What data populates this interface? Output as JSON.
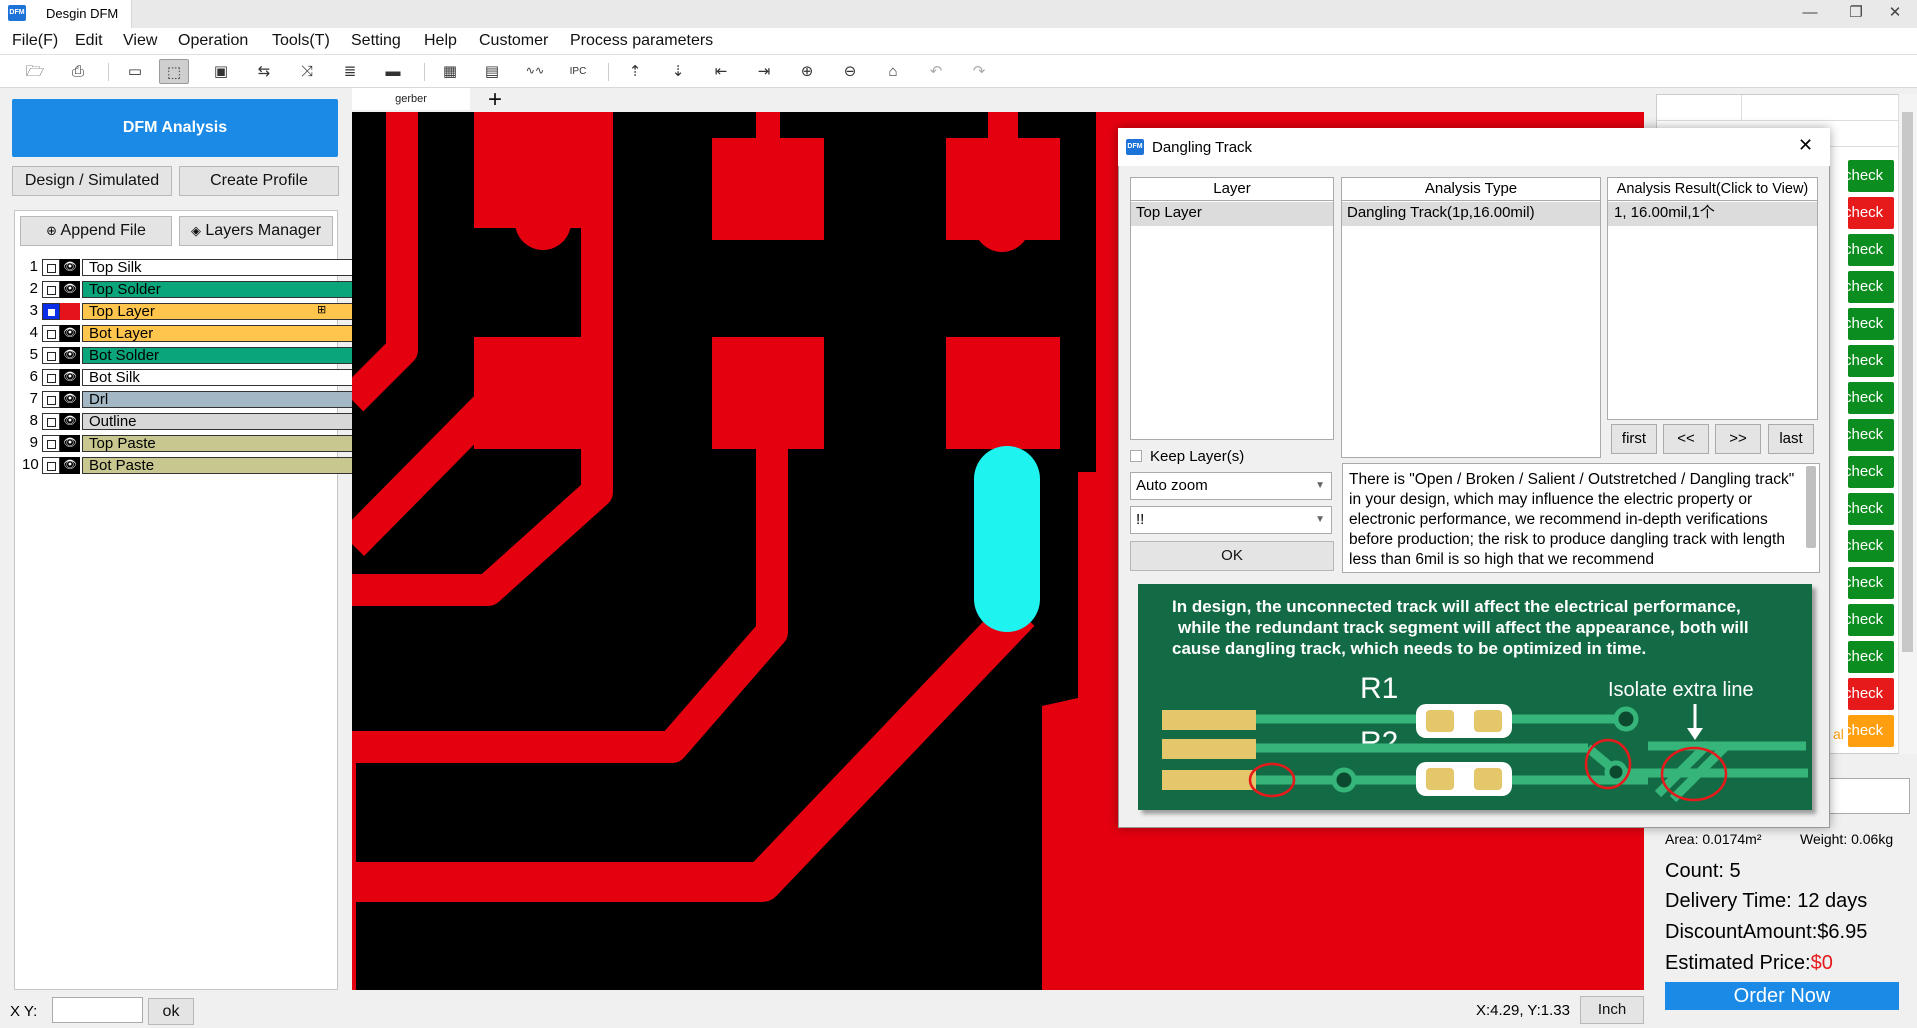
{
  "window": {
    "title": "Desgin DFM",
    "app_icon": "DFM",
    "minimize": "—",
    "maximize": "❐",
    "close": "✕"
  },
  "menu": [
    "File(F)",
    "Edit",
    "View",
    "Operation",
    "Tools(T)",
    "Setting",
    "Help",
    "Customer",
    "Process parameters"
  ],
  "toolbar": {
    "icons": [
      "open-file-icon",
      "print-icon",
      "window-icon",
      "select-icon",
      "zoom-box-icon",
      "route-icon",
      "split-icon",
      "stack-icon",
      "ruler-icon",
      "qr-icon",
      "chip-icon",
      "wave-icon",
      "ipc-icon",
      "export-icon",
      "import-icon",
      "align-left-icon",
      "align-right-icon",
      "zoom-in-icon",
      "zoom-out-icon",
      "home-icon",
      "undo-icon",
      "redo-icon"
    ]
  },
  "left": {
    "dfm_button": "DFM Analysis",
    "design_button": "Design / Simulated",
    "profile_button": "Create Profile",
    "append_button": "Append File",
    "layers_button": "Layers Manager",
    "layers": [
      {
        "num": "1",
        "name": "Top Silk",
        "color": "#ffffff",
        "eye": "👁"
      },
      {
        "num": "2",
        "name": "Top Solder",
        "color": "#0aa57a",
        "eye": "👁"
      },
      {
        "num": "3",
        "name": "Top Layer",
        "color": "#ffc54d",
        "eye": "",
        "selected": true
      },
      {
        "num": "4",
        "name": "Bot Layer",
        "color": "#ffc54d",
        "eye": "👁"
      },
      {
        "num": "5",
        "name": "Bot Solder",
        "color": "#0aa57a",
        "eye": "👁"
      },
      {
        "num": "6",
        "name": "Bot Silk",
        "color": "#ffffff",
        "eye": "👁"
      },
      {
        "num": "7",
        "name": "Drl",
        "color": "#a3b8c4",
        "eye": "👁"
      },
      {
        "num": "8",
        "name": "Outline",
        "color": "#d8d8d8",
        "eye": "👁"
      },
      {
        "num": "9",
        "name": "Top Paste",
        "color": "#c8c790",
        "eye": "👁"
      },
      {
        "num": "10",
        "name": "Bot Paste",
        "color": "#c8c790",
        "eye": "👁"
      }
    ],
    "xy_label": "X Y:",
    "xy_ok": "ok"
  },
  "canvas": {
    "tab": "gerber",
    "add_tab": "+",
    "coords": "X:4.29, Y:1.33",
    "unit": "Inch"
  },
  "dialog": {
    "title": "Dangling Track",
    "icon": "DFM",
    "close": "✕",
    "col_layer": "Layer",
    "col_type": "Analysis Type",
    "col_result": "Analysis Result(Click to View)",
    "layer_value": "Top Layer",
    "type_value": "Dangling Track(1p,16.00mil)",
    "result_value": "1, 16.00mil,1个",
    "keep_layers": "Keep Layer(s)",
    "zoom_select": "Auto zoom",
    "severity_select": "!!",
    "ok": "OK",
    "nav": [
      "first",
      "<<",
      ">>",
      "last"
    ],
    "description": "There is \"Open / Broken / Salient / Outstretched / Dangling track\" in your design, which may influence the electric property or electronic performance, we recommend in-depth verifications before production; the risk to produce dangling track with length less than 6mil is so high that we recommend",
    "illustration": {
      "text_lines": [
        "In design, the unconnected track will affect the electrical performance,",
        "while the redundant track segment will affect the appearance, both will",
        "cause dangling track, which needs to be optimized in time."
      ],
      "label_r1": "R1",
      "label_r2": "R2",
      "label_isolate": "Isolate extra line"
    }
  },
  "right": {
    "checks": [
      {
        "label": "check",
        "status": "green"
      },
      {
        "label": "check",
        "status": "red"
      },
      {
        "label": "check",
        "status": "green"
      },
      {
        "label": "check",
        "status": "green"
      },
      {
        "label": "check",
        "status": "green"
      },
      {
        "label": "check",
        "status": "green"
      },
      {
        "label": "check",
        "status": "green"
      },
      {
        "label": "check",
        "status": "green"
      },
      {
        "label": "check",
        "status": "green"
      },
      {
        "label": "check",
        "status": "green"
      },
      {
        "label": "check",
        "status": "green"
      },
      {
        "label": "check",
        "status": "green"
      },
      {
        "label": "check",
        "status": "green"
      },
      {
        "label": "check",
        "status": "green"
      },
      {
        "label": "check",
        "status": "red"
      },
      {
        "label": "check",
        "status": "orange"
      }
    ],
    "partial_label": "al",
    "area": "Area: 0.0174m²",
    "weight": "Weight: 0.06kg",
    "count": "Count: 5",
    "delivery": "Delivery Time: 12 days",
    "discount": "DiscountAmount:$6.95",
    "price_label": "Estimated Price:",
    "price_value": "$0",
    "order": "Order Now"
  },
  "colors": {
    "accent": "#1a8ae6",
    "copper": "#e5000f",
    "highlight": "#1ff3ef",
    "pass": "#0b8d1f",
    "fail": "#e61a1a",
    "warn": "#ff9f10"
  }
}
